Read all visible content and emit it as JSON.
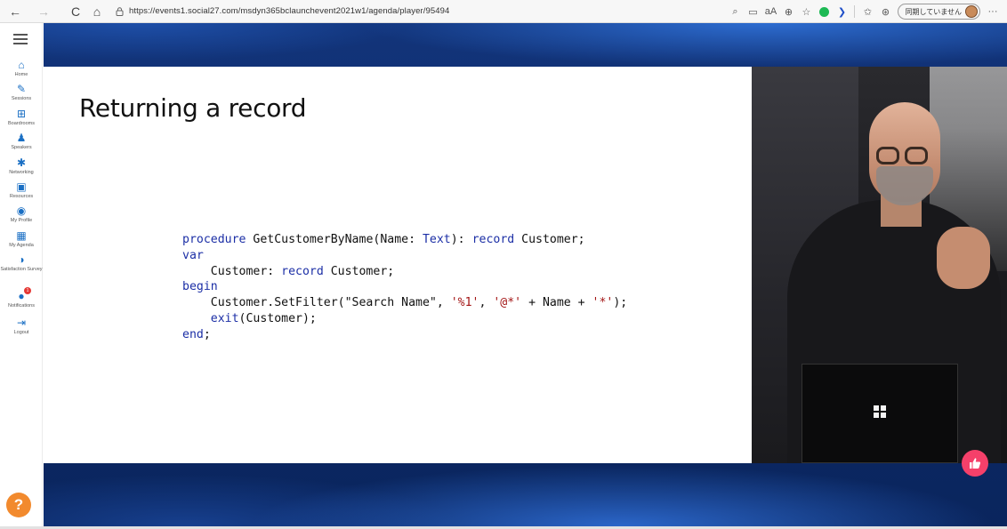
{
  "browser": {
    "url": "https://events1.social27.com/msdyn365bclaunchevent2021w1/agenda/player/95494",
    "sync_label": "同期していません",
    "icons": {
      "back": "←",
      "forward": "→",
      "reload": "C",
      "home": "⌂",
      "lock": "🔒",
      "more": "···"
    }
  },
  "sidebar": {
    "items": [
      {
        "label": "Home",
        "icon": "home-icon",
        "glyph": "⌂"
      },
      {
        "label": "Sessions",
        "icon": "pencil-icon",
        "glyph": "✎"
      },
      {
        "label": "Boardrooms",
        "icon": "boardroom-icon",
        "glyph": "⊞"
      },
      {
        "label": "Speakers",
        "icon": "speaker-icon",
        "glyph": "♟"
      },
      {
        "label": "Networking",
        "icon": "networking-icon",
        "glyph": "✱"
      },
      {
        "label": "Resources",
        "icon": "resources-icon",
        "glyph": "▣"
      },
      {
        "label": "My Profile",
        "icon": "profile-icon",
        "glyph": "◉"
      },
      {
        "label": "My Agenda",
        "icon": "calendar-icon",
        "glyph": "▦"
      },
      {
        "label": "Satisfaction Survey",
        "icon": "survey-icon",
        "glyph": "◑"
      },
      {
        "label": "Notifications",
        "icon": "bell-icon",
        "glyph": "●",
        "badge": "1"
      },
      {
        "label": "Logout",
        "icon": "logout-icon",
        "glyph": "⇥"
      }
    ],
    "help_glyph": "?"
  },
  "slide": {
    "title": "Returning a record",
    "code_lines": [
      [
        {
          "t": "procedure",
          "c": "kw"
        },
        {
          "t": " GetCustomerByName(Name: ",
          "c": ""
        },
        {
          "t": "Text",
          "c": "kw"
        },
        {
          "t": "): ",
          "c": ""
        },
        {
          "t": "record",
          "c": "kw"
        },
        {
          "t": " Customer;",
          "c": ""
        }
      ],
      [
        {
          "t": "var",
          "c": "kw"
        }
      ],
      [
        {
          "t": "    Customer: ",
          "c": ""
        },
        {
          "t": "record",
          "c": "kw"
        },
        {
          "t": " Customer;",
          "c": ""
        }
      ],
      [
        {
          "t": "begin",
          "c": "kw"
        }
      ],
      [
        {
          "t": "    Customer.SetFilter(\"Search Name\", ",
          "c": ""
        },
        {
          "t": "'%1'",
          "c": "str"
        },
        {
          "t": ", ",
          "c": ""
        },
        {
          "t": "'@*'",
          "c": "str"
        },
        {
          "t": " + Name + ",
          "c": ""
        },
        {
          "t": "'*'",
          "c": "str"
        },
        {
          "t": ");",
          "c": ""
        }
      ],
      [
        {
          "t": "    ",
          "c": ""
        },
        {
          "t": "exit",
          "c": "kw"
        },
        {
          "t": "(Customer);",
          "c": ""
        }
      ],
      [
        {
          "t": "end",
          "c": "kw"
        },
        {
          "t": ";",
          "c": ""
        }
      ]
    ]
  },
  "colors": {
    "keyword": "#1c2fa6",
    "string": "#a31515",
    "accent": "#1a6fc4",
    "help": "#f28a2e",
    "like": "#f5406a",
    "stage": "#0d2b6a"
  },
  "like_glyph": "👍"
}
